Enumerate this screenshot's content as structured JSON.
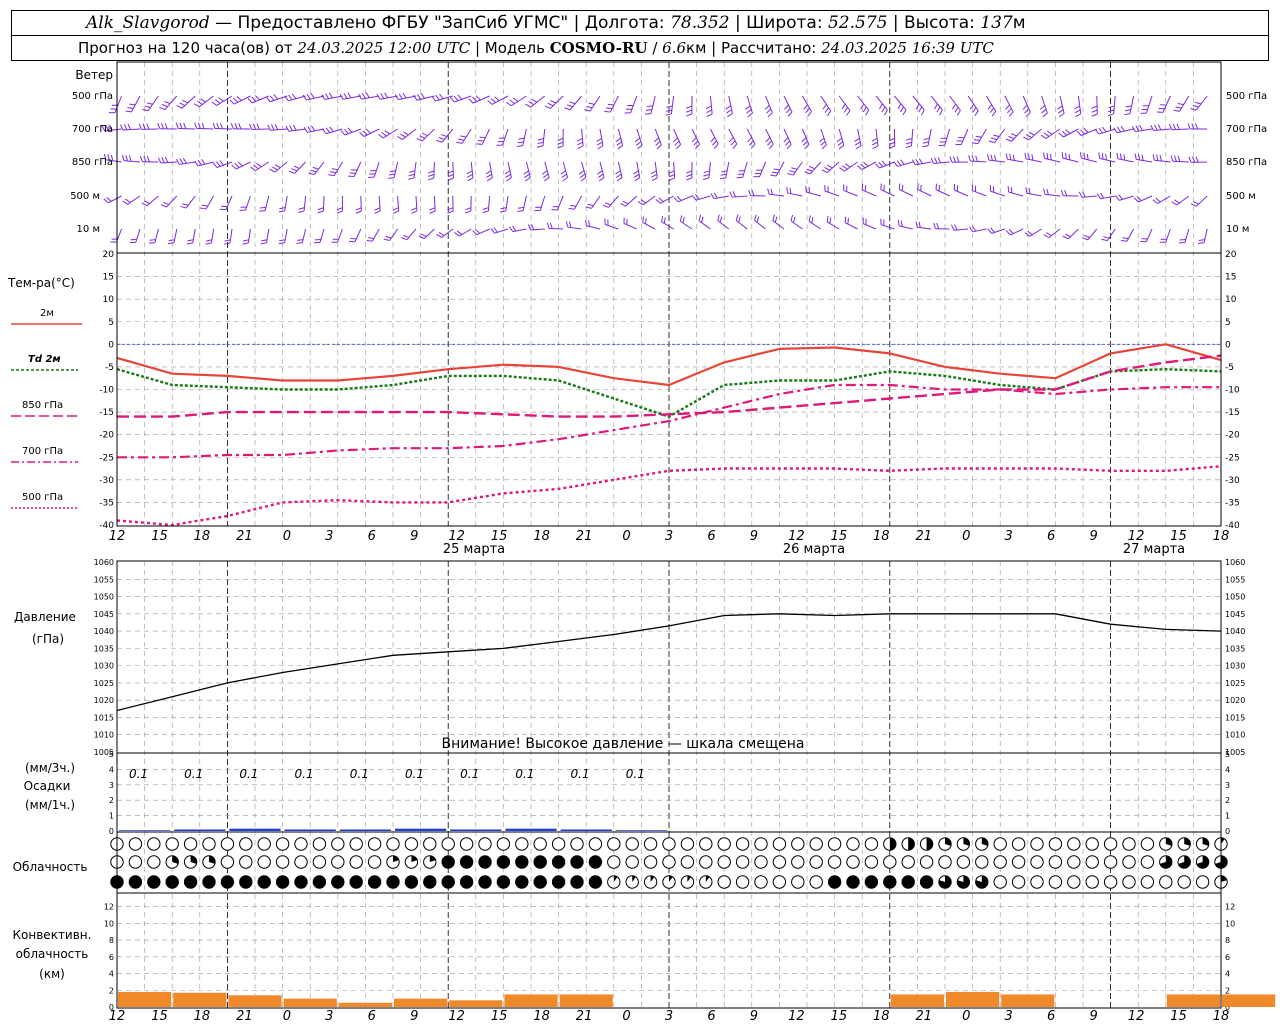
{
  "header": {
    "station": "Alk_Slavgorod",
    "provider": " — Предоставлено ФГБУ \"ЗапСиб УГМС\" | Долгота: ",
    "lon": "78.352",
    "sep_lat": " | Широта: ",
    "lat": "52.575",
    "sep_alt": " | Высота: ",
    "alt": "137",
    "alt_unit": "м",
    "forecast_prefix": "Прогноз на 120 часа(ов) от ",
    "forecast_start": "24.03.2025 12:00 UTC",
    "model_prefix": " | Модель ",
    "model": "COSMO-RU",
    "res_prefix": " / ",
    "res": "6.6",
    "res_unit": "км",
    "calc_prefix": " | Рассчитано: ",
    "calc_time": "24.03.2025 16:39 UTC"
  },
  "panels": {
    "wind": {
      "title": "Ветер",
      "levels": [
        "500 гПа",
        "700 гПа",
        "850 гПа",
        "500 м",
        "10 м"
      ],
      "color": "#7a2adf"
    },
    "temperature": {
      "title": "Тем-ра(°C)",
      "legend": [
        {
          "label": "2м",
          "color": "#e8453a",
          "style": "solid"
        },
        {
          "label": "Td 2м",
          "color": "#1a7a1a",
          "style": "dotted"
        },
        {
          "label": "850 гПа",
          "color": "#e0187a",
          "style": "dash"
        },
        {
          "label": "700 гПа",
          "color": "#e0187a",
          "style": "dashdot"
        },
        {
          "label": "500 гПа",
          "color": "#e0187a",
          "style": "dot"
        }
      ],
      "yticks": [
        "20",
        "15",
        "10",
        "5",
        "0",
        "-5",
        "-10",
        "-15",
        "-20",
        "-25",
        "-30",
        "-35",
        "-40"
      ],
      "zero_line_color": "#3a4ad8"
    },
    "pressure": {
      "title_line1": "Давление",
      "title_line2": "(гПа)",
      "yticks": [
        "1060",
        "1055",
        "1050",
        "1045",
        "1040",
        "1035",
        "1030",
        "1025",
        "1020",
        "1015",
        "1010",
        "1005"
      ],
      "warning": "Внимание! Высокое давление — шкала смещена"
    },
    "precip": {
      "title_line1": "(мм/3ч.)",
      "title_line2": "Осадки",
      "title_line3": "(мм/1ч.)",
      "yticks": [
        "5",
        "4",
        "3",
        "2",
        "1",
        "0"
      ],
      "labels": [
        "0.1",
        "0.1",
        "0.1",
        "0.1",
        "0.1",
        "0.1",
        "0.1",
        "0.1",
        "0.1",
        "0.1"
      ],
      "color": "#1f3fd8"
    },
    "clouds": {
      "title": "Облачность"
    },
    "convective": {
      "title_line1": "Конвективн.",
      "title_line2": "облачность",
      "title_line3": "(км)",
      "yticks": [
        "12",
        "10",
        "8",
        "6",
        "4",
        "2",
        "0"
      ],
      "color": "#f0892a"
    }
  },
  "x_axis": {
    "tick_labels": [
      "12",
      "15",
      "18",
      "21",
      "0",
      "3",
      "6",
      "9",
      "12",
      "15",
      "18",
      "21",
      "0",
      "3",
      "6",
      "9",
      "12",
      "15",
      "18",
      "21",
      "0",
      "3",
      "6",
      "9",
      "12",
      "15",
      "18"
    ],
    "day_labels": [
      "25 марта",
      "26 марта",
      "27 марта"
    ]
  },
  "chart_data": {
    "type": "line",
    "x_hours": [
      0,
      6,
      12,
      18,
      24,
      30,
      36,
      42,
      48,
      54,
      60,
      66,
      72,
      78,
      84,
      90,
      96,
      102,
      108,
      114,
      120
    ],
    "series": [
      {
        "name": "2м",
        "unit": "°C",
        "values": [
          -3,
          -6.5,
          -7,
          -8,
          -8,
          -7,
          -5.5,
          -4.5,
          -5,
          -7.5,
          -9,
          -4,
          -1,
          -0.7,
          -2,
          -5,
          -6.5,
          -7.5,
          -2,
          0,
          -3.5
        ]
      },
      {
        "name": "Td 2м",
        "unit": "°C",
        "values": [
          -5.5,
          -9,
          -9.5,
          -10,
          -10,
          -9,
          -7,
          -7,
          -8,
          -12,
          -16,
          -9,
          -8,
          -8,
          -6,
          -7,
          -9,
          -10,
          -6,
          -5.5,
          -6
        ]
      },
      {
        "name": "850 гПа",
        "unit": "°C",
        "values": [
          -16,
          -16,
          -15,
          -15,
          -15,
          -15,
          -15,
          -15.5,
          -16,
          -16,
          -15.5,
          -15,
          -14,
          -13,
          -12,
          -11,
          -10,
          -10,
          -6,
          -4,
          -2.5
        ]
      },
      {
        "name": "700 гПа",
        "unit": "°C",
        "values": [
          -25,
          -25,
          -24.5,
          -24.5,
          -23.5,
          -23,
          -23,
          -22.5,
          -21,
          -19,
          -17,
          -14,
          -11,
          -9,
          -9,
          -10,
          -10,
          -11,
          -10,
          -9.5,
          -9.5
        ]
      },
      {
        "name": "500 гПа",
        "unit": "°C",
        "values": [
          -39,
          -40,
          -38,
          -35,
          -34.5,
          -35,
          -35,
          -33,
          -32,
          -30,
          -28,
          -27.5,
          -27.5,
          -27.5,
          -28,
          -27.5,
          -27.5,
          -27.5,
          -28,
          -28,
          -27
        ]
      },
      {
        "name": "Давление",
        "unit": "гПа",
        "values": [
          1017,
          1021,
          1025,
          1028,
          1030.5,
          1033,
          1034,
          1035,
          1037,
          1039,
          1041.5,
          1044.5,
          1045,
          1044.5,
          1045,
          1045,
          1045,
          1045,
          1042,
          1040.5,
          1040
        ]
      }
    ],
    "temp_ylim": [
      -40,
      20
    ],
    "pressure_ylim": [
      1005,
      1060
    ],
    "precip_ylim": [
      0,
      5
    ],
    "precip_mm_per_1h": [
      0.05,
      0.1,
      0.15,
      0.1,
      0.1,
      0.15,
      0.1,
      0.15,
      0.1,
      0.05,
      0,
      0,
      0,
      0,
      0,
      0,
      0,
      0,
      0,
      0,
      0
    ],
    "convective_km": [
      1.8,
      1.7,
      1.4,
      1,
      0.5,
      1,
      0.8,
      1.5,
      1.5,
      0,
      0,
      0,
      0,
      0,
      1.5,
      1.8,
      1.5,
      0,
      0,
      1.5,
      1.5
    ],
    "cloud_cover_low": [
      0.9,
      0.9,
      0.9,
      0.9,
      0.9,
      0.9,
      0.9,
      0.9,
      0.9,
      0.1,
      0.1,
      0,
      0,
      0.9,
      0.9,
      0.8,
      0,
      0,
      0,
      0,
      0.2
    ],
    "cloud_cover_mid": [
      0,
      0.3,
      0,
      0,
      0,
      0.2,
      0.9,
      0.9,
      0.9,
      0,
      0,
      0,
      0,
      0,
      0,
      0,
      0,
      0,
      0,
      0.7,
      0.7
    ],
    "cloud_cover_high": [
      0,
      0,
      0,
      0,
      0,
      0,
      0,
      0,
      0,
      0,
      0,
      0,
      0,
      0,
      0.5,
      0.3,
      0,
      0,
      0,
      0.3,
      0.1
    ],
    "grid": true
  }
}
